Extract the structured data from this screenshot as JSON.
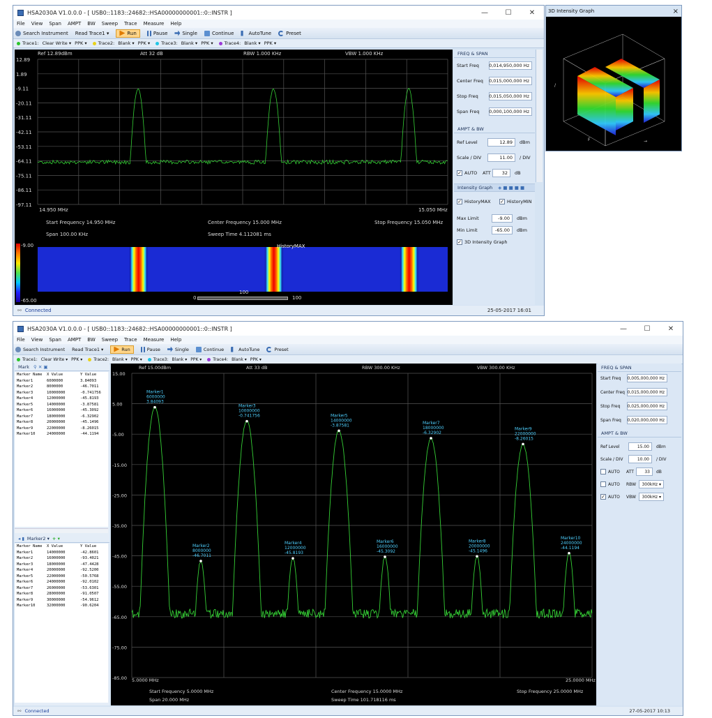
{
  "top": {
    "title": "HSA2030A V1.0.0.0   -  [ USB0::1183::24682::HSA00000000001::0::INSTR ]",
    "menu": [
      "File",
      "View",
      "Span",
      "AMPT",
      "BW",
      "Sweep",
      "Trace",
      "Measure",
      "Help"
    ],
    "toolbar": {
      "search": "Search Instrument",
      "read": "Read Trace1",
      "run": "Run",
      "pause": "Pause",
      "single": "Single",
      "continue": "Continue",
      "autotune": "AutoTune",
      "preset": "Preset"
    },
    "traces": [
      {
        "label": "Trace1:",
        "mode": "Clear Write",
        "det": "PPK",
        "color": "#2bc42b"
      },
      {
        "label": "Trace2:",
        "mode": "Blank",
        "det": "PPK",
        "color": "#e8d21a"
      },
      {
        "label": "Trace3:",
        "mode": "Blank",
        "det": "PPK",
        "color": "#21c6e6"
      },
      {
        "label": "Trace4:",
        "mode": "Blank",
        "det": "PPK",
        "color": "#9b3ad8"
      }
    ],
    "header": {
      "ref": "Ref 12.89dBm",
      "att": "Att 32 dB",
      "rbw": "RBW 1.000 KHz",
      "vbw": "VBW 1.000 KHz"
    },
    "y_ticks": [
      "12.89",
      "1.89",
      "-9.11",
      "-20.11",
      "-31.11",
      "-42.11",
      "-53.11",
      "-64.11",
      "-75.11",
      "-86.11",
      "-97.11"
    ],
    "x_start": "14.950 MHz",
    "x_stop": "15.050 MHz",
    "info": {
      "start": "Start Frequency  14.950 MHz",
      "center": "Center Frequency  15.000 MHz",
      "stop": "Stop Frequency  15.050 MHz",
      "span": "Span  100.00 KHz",
      "sweep": "Sweep Time  4.112081 ms"
    },
    "intensity": {
      "top": "-9.00",
      "bottom": "-65.00",
      "marker": "HistoryMAX",
      "slider_mid": "100",
      "slider_left": "0",
      "slider_right": "100"
    },
    "panel": {
      "freq_title": "FREQ & SPAN",
      "start_label": "Start Freq",
      "start_val": "0,014,950,000 Hz",
      "center_label": "Center Freq",
      "center_val": "0,015,000,000 Hz",
      "stop_label": "Stop Freq",
      "stop_val": "0,015,050,000 Hz",
      "span_label": "Span Freq",
      "span_val": "0,000,100,000 Hz",
      "ampt_title": "AMPT & BW",
      "ref_label": "Ref Level",
      "ref_val": "12.89",
      "ref_unit": "dBm",
      "scale_label": "Scale / DIV",
      "scale_val": "11.00",
      "scale_unit": "/ DIV",
      "auto_label": "AUTO",
      "att_label": "ATT",
      "att_val": "32",
      "att_unit": "dB",
      "ig_title": "Intensity Graph",
      "hmax": "HistoryMAX",
      "hmin": "HistoryMIN",
      "max_label": "Max Limit",
      "max_val": "-9.00",
      "max_unit": "dBm",
      "min_label": "Min Limit",
      "min_val": "-65.00",
      "min_unit": "dBm",
      "g3d": "3D Intensity Graph"
    },
    "status": "Connected",
    "timestamp": "25-05-2017  16:01"
  },
  "graph3d": {
    "title": "3D Intensity Graph",
    "close": "×"
  },
  "bottom": {
    "title": "HSA2030A V1.0.0.0   -  [ USB0::1183::24682::HSA00000000001::0::INSTR ]",
    "menu": [
      "File",
      "View",
      "Span",
      "AMPT",
      "BW",
      "Sweep",
      "Trace",
      "Measure",
      "Help"
    ],
    "toolbar": {
      "search": "Search Instrument",
      "read": "Read Trace1",
      "run": "Run",
      "pause": "Pause",
      "single": "Single",
      "continue": "Continue",
      "autotune": "AutoTune",
      "preset": "Preset"
    },
    "traces": [
      {
        "label": "Trace1:",
        "mode": "Clear Write",
        "det": "PPK",
        "color": "#2bc42b"
      },
      {
        "label": "Trace2:",
        "mode": "Blank",
        "det": "PPK",
        "color": "#e8d21a"
      },
      {
        "label": "Trace3:",
        "mode": "Blank",
        "det": "PPK",
        "color": "#21c6e6"
      },
      {
        "label": "Trace4:",
        "mode": "Blank",
        "det": "PPK",
        "color": "#9b3ad8"
      }
    ],
    "mark_title": "Mark",
    "table1": {
      "headers": [
        "Marker Name",
        "X Value",
        "Y Value"
      ],
      "rows": [
        [
          "Marker1",
          "6000000",
          "3.84093"
        ],
        [
          "Marker2",
          "8000000",
          "-46.7011"
        ],
        [
          "Marker3",
          "10000000",
          "-0.741756"
        ],
        [
          "Marker4",
          "12000000",
          "-45.8193"
        ],
        [
          "Marker5",
          "14000000",
          "-3.87581"
        ],
        [
          "Marker6",
          "16000000",
          "-45.3092"
        ],
        [
          "Marker7",
          "18000000",
          "-6.32902"
        ],
        [
          "Marker8",
          "20000000",
          "-45.1496"
        ],
        [
          "Marker9",
          "22000000",
          "-8.26015"
        ],
        [
          "Marker10",
          "24000000",
          "-44.1194"
        ]
      ]
    },
    "marker2_dd": "Marker2",
    "table2": {
      "headers": [
        "Marker Name",
        "X Value",
        "Y Value"
      ],
      "rows": [
        [
          "Marker1",
          "14000000",
          "-42.8601"
        ],
        [
          "Marker2",
          "16000000",
          "-93.4021"
        ],
        [
          "Marker3",
          "18000000",
          "-47.4428"
        ],
        [
          "Marker4",
          "20000000",
          "-92.5200"
        ],
        [
          "Marker5",
          "22000000",
          "-50.5768"
        ],
        [
          "Marker6",
          "24000000",
          "-92.0102"
        ],
        [
          "Marker7",
          "26000000",
          "-53.6301"
        ],
        [
          "Marker8",
          "28000000",
          "-91.0507"
        ],
        [
          "Marker9",
          "30000000",
          "-54.9612"
        ],
        [
          "Marker10",
          "32000000",
          "-90.6204"
        ]
      ]
    },
    "header": {
      "ref": "Ref 15.00dBm",
      "att": "Att 33 dB",
      "rbw": "RBW 300.00 KHz",
      "vbw": "VBW 300.00 KHz"
    },
    "y_ticks": [
      "15.00",
      "5.00",
      "-5.00",
      "-15.00",
      "-25.00",
      "-35.00",
      "-45.00",
      "-55.00",
      "-65.00",
      "-75.00",
      "-85.00"
    ],
    "x_start": "5.0000 MHz",
    "x_stop": "25.0000 MHz",
    "markers": [
      {
        "name": "Marker1",
        "x": "6000000",
        "y": "3.84093"
      },
      {
        "name": "Marker2",
        "x": "8000000",
        "y": "-46.7011"
      },
      {
        "name": "Marker3",
        "x": "10000000",
        "y": "-0.741756"
      },
      {
        "name": "Marker4",
        "x": "12000000",
        "y": "-45.8193"
      },
      {
        "name": "Marker5",
        "x": "14000000",
        "y": "-3.87581"
      },
      {
        "name": "Marker6",
        "x": "16000000",
        "y": "-45.3092"
      },
      {
        "name": "Marker7",
        "x": "18000000",
        "y": "-6.32902"
      },
      {
        "name": "Marker8",
        "x": "20000000",
        "y": "-45.1496"
      },
      {
        "name": "Marker9",
        "x": "22000000",
        "y": "-8.26015"
      },
      {
        "name": "Marker10",
        "x": "24000000",
        "y": "-44.1194"
      }
    ],
    "info": {
      "start": "Start Frequency  5.0000 MHz",
      "center": "Center Frequency  15.0000 MHz",
      "stop": "Stop Frequency  25.0000 MHz",
      "span": "Span  20.000 MHz",
      "sweep": "Sweep Time  101.718116 ms"
    },
    "panel": {
      "freq_title": "FREQ & SPAN",
      "start_label": "Start Freq",
      "start_val": "0,005,000,000 Hz",
      "center_label": "Center Freq",
      "center_val": "0,015,000,000 Hz",
      "stop_label": "Stop Freq",
      "stop_val": "0,025,000,000 Hz",
      "span_label": "Span Freq",
      "span_val": "0,020,000,000 Hz",
      "ampt_title": "AMPT & BW",
      "ref_label": "Ref Level",
      "ref_val": "15.00",
      "ref_unit": "dBm",
      "scale_label": "Scale / DIV",
      "scale_val": "10.00",
      "scale_unit": "/ DIV",
      "auto_label": "AUTO",
      "att_label": "ATT",
      "att_val": "33",
      "att_unit": "dB",
      "rbw_label": "RBW",
      "rbw_val": "300kHz",
      "vbw_label": "VBW",
      "vbw_val": "300kHz"
    },
    "status": "Connected",
    "timestamp": "27-05-2017  10:13"
  }
}
